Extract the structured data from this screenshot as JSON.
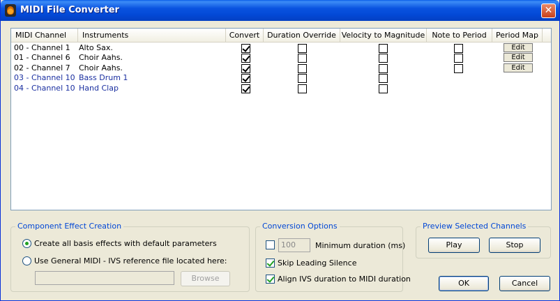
{
  "window": {
    "title": "MIDI File Converter",
    "close_glyph": "✕"
  },
  "table": {
    "headers": [
      "MIDI Channel",
      "Instruments",
      "Convert",
      "Duration Override",
      "Velocity to Magnitude",
      "Note to Period",
      "Period Map"
    ],
    "rows": [
      {
        "channel": "00 - Channel 1",
        "instrument": "Alto Sax.",
        "convert": true,
        "duration": false,
        "velocity": false,
        "note": false,
        "period_map": "Edit",
        "percussion": false
      },
      {
        "channel": "01 - Channel 6",
        "instrument": "Choir Aahs.",
        "convert": true,
        "duration": false,
        "velocity": false,
        "note": false,
        "period_map": "Edit",
        "percussion": false
      },
      {
        "channel": "02 - Channel 7",
        "instrument": "Choir Aahs.",
        "convert": true,
        "duration": false,
        "velocity": false,
        "note": false,
        "period_map": "Edit",
        "percussion": false
      },
      {
        "channel": "03 - Channel 10",
        "instrument": "Bass Drum 1",
        "convert": true,
        "duration": false,
        "velocity": false,
        "note": null,
        "period_map": "",
        "percussion": true
      },
      {
        "channel": "04 - Channel 10",
        "instrument": "Hand Clap",
        "convert": true,
        "duration": false,
        "velocity": false,
        "note": null,
        "period_map": "",
        "percussion": true
      }
    ]
  },
  "component_effect": {
    "label": "Component Effect Creation",
    "option_default": "Create all basis effects with default parameters",
    "option_reference": "Use General MIDI - IVS reference file located here:",
    "selected": "default",
    "file_path": "",
    "browse_label": "Browse"
  },
  "conversion": {
    "label": "Conversion Options",
    "min_duration_value": "100",
    "min_duration_label": "Minimum duration (ms)",
    "min_duration_checked": false,
    "skip_silence_label": "Skip Leading Silence",
    "skip_silence_checked": true,
    "align_label": "Align IVS duration to MIDI duration",
    "align_checked": true
  },
  "preview": {
    "label": "Preview Selected Channels",
    "play_label": "Play",
    "stop_label": "Stop"
  },
  "footer": {
    "ok_label": "OK",
    "cancel_label": "Cancel"
  },
  "colors": {
    "title_bar": "#0a53e0",
    "group_label": "#0046d5",
    "percussion_text": "#1a2fa0"
  }
}
